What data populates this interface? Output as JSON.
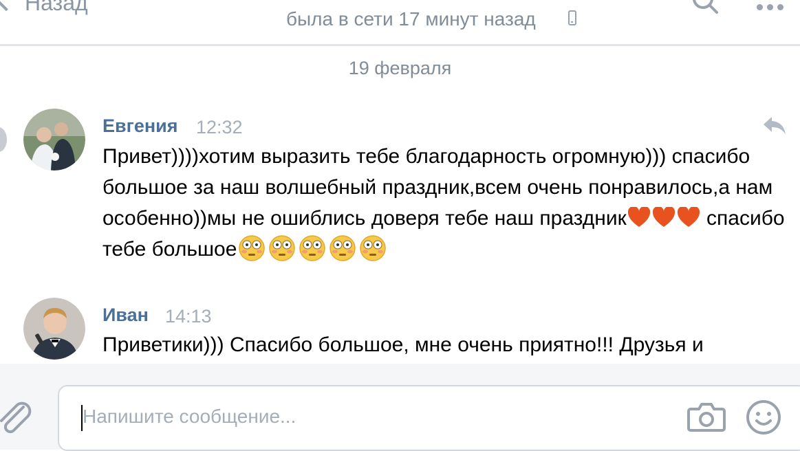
{
  "header": {
    "back_label": "Назад",
    "status": "была в сети 17 минут назад"
  },
  "date_separator": "19 февраля",
  "messages": [
    {
      "author": "Евгения",
      "time": "12:32",
      "text_main": "Привет))))хотим выразить тебе благодарность огромную))) спасибо большое за наш волшебный праздник,всем очень понравилось,а нам особенно))мы не ошиблись доверя тебе наш праздник",
      "text_after_hearts": " спасибо тебе большое"
    },
    {
      "author": "Иван",
      "time": "14:13",
      "text": "Приветики))) Спасибо большое, мне очень приятно!!! Друзья и"
    }
  ],
  "composer": {
    "placeholder": "Напишите сообщение..."
  },
  "colors": {
    "author": "#4a6f99",
    "meta": "#818c99",
    "icon": "#99a2ad",
    "heart": "#e8521e"
  }
}
